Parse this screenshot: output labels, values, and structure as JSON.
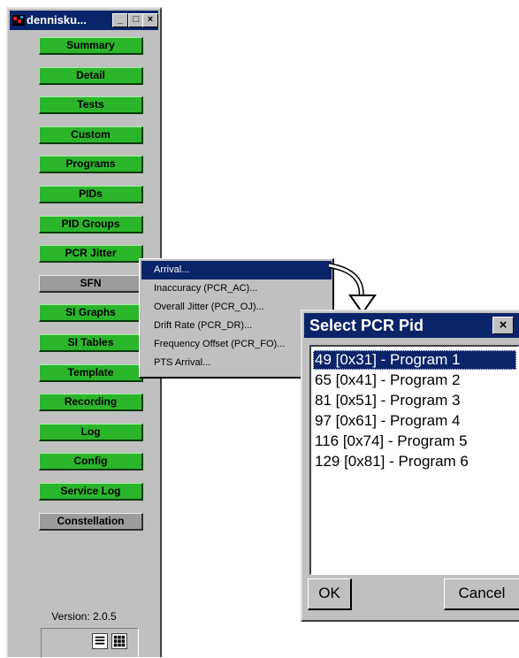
{
  "main_window": {
    "title": "dennisku...",
    "controls": {
      "minimize": "_",
      "maximize": "□",
      "close": "×"
    },
    "nav": [
      {
        "label": "Summary",
        "style": "green"
      },
      {
        "label": "Detail",
        "style": "green"
      },
      {
        "label": "Tests",
        "style": "green"
      },
      {
        "label": "Custom",
        "style": "green"
      },
      {
        "label": "Programs",
        "style": "green"
      },
      {
        "label": "PIDs",
        "style": "green"
      },
      {
        "label": "PID Groups",
        "style": "green"
      },
      {
        "label": "PCR Jitter",
        "style": "green"
      },
      {
        "label": "SFN",
        "style": "gray"
      },
      {
        "label": "SI Graphs",
        "style": "green"
      },
      {
        "label": "SI Tables",
        "style": "green"
      },
      {
        "label": "Template",
        "style": "green"
      },
      {
        "label": "Recording",
        "style": "green"
      },
      {
        "label": "Log",
        "style": "green"
      },
      {
        "label": "Config",
        "style": "green"
      },
      {
        "label": "Service Log",
        "style": "green"
      },
      {
        "label": "Constellation",
        "style": "gray"
      }
    ],
    "version": "Version: 2.0.5"
  },
  "popup_menu": {
    "items": [
      {
        "label": "Arrival...",
        "selected": true
      },
      {
        "label": "Inaccuracy (PCR_AC)...",
        "selected": false
      },
      {
        "label": "Overall Jitter (PCR_OJ)...",
        "selected": false
      },
      {
        "label": "Drift Rate (PCR_DR)...",
        "selected": false
      },
      {
        "label": "Frequency Offset (PCR_FO)...",
        "selected": false
      },
      {
        "label": "PTS Arrival...",
        "selected": false
      }
    ]
  },
  "dialog": {
    "title": "Select PCR Pid",
    "close_label": "×",
    "pids": [
      {
        "label": "49 [0x31] - Program 1",
        "selected": true
      },
      {
        "label": "65 [0x41] - Program 2",
        "selected": false
      },
      {
        "label": "81 [0x51] - Program 3",
        "selected": false
      },
      {
        "label": "97 [0x61] - Program 4",
        "selected": false
      },
      {
        "label": "116 [0x74] - Program 5",
        "selected": false
      },
      {
        "label": "129 [0x81] - Program 6",
        "selected": false
      }
    ],
    "ok_label": "OK",
    "cancel_label": "Cancel"
  },
  "colors": {
    "titlebar": "#0a246a",
    "nav_green": "#2bb52b",
    "nav_gray": "#9c9c9c",
    "window_face": "#c0c0c0"
  }
}
